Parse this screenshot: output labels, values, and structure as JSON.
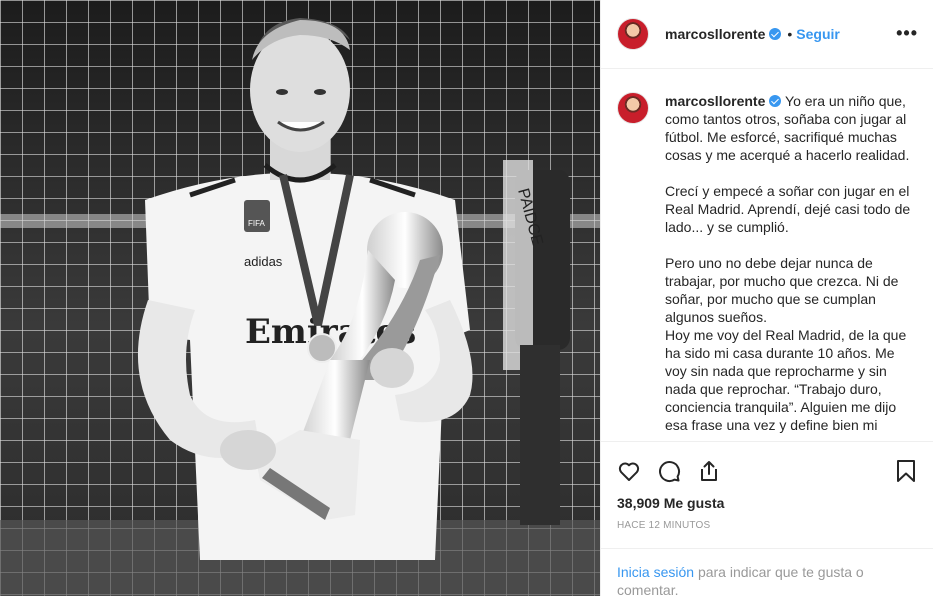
{
  "post": {
    "username": "marcosllorente",
    "dot": "•",
    "follow_label": "Seguir",
    "more_label": "•••",
    "caption": "Yo era un niño que, como tantos otros, soñaba con jugar al fútbol. Me esforcé, sacrifiqué muchas cosas y me acerqué a hacerlo realidad.\n\nCrecí y empecé a soñar con jugar en el Real Madrid. Aprendí, dejé casi todo de lado... y se cumplió.\n\nPero uno no debe dejar nunca de trabajar, por mucho que crezca. Ni de soñar, por mucho que se cumplan algunos sueños.\nHoy me voy del Real Madrid, de la que ha sido mi casa durante 10 años. Me voy sin nada que reprocharme y sin nada que reprochar. “Trabajo duro, conciencia tranquila”. Alguien me dijo esa frase una vez y define bien mi",
    "likes_count": "38,909",
    "likes_label": "Me gusta",
    "timestamp": "HACE 12 MINUTOS",
    "login_link": "Inicia sesión",
    "login_text": "para indicar que te gusta o comentar."
  },
  "photo": {
    "shirt_text": "Emirates",
    "brand_text": "adidas",
    "badge_text": "FIFA",
    "sign_text": "PAIDCE"
  },
  "icons": [
    "heart-icon",
    "comment-icon",
    "share-icon",
    "bookmark-icon",
    "more-options-icon",
    "verified-badge-icon"
  ],
  "colors": {
    "accent": "#3897f0",
    "text": "#262626",
    "muted": "#999999",
    "border": "#efefef"
  }
}
